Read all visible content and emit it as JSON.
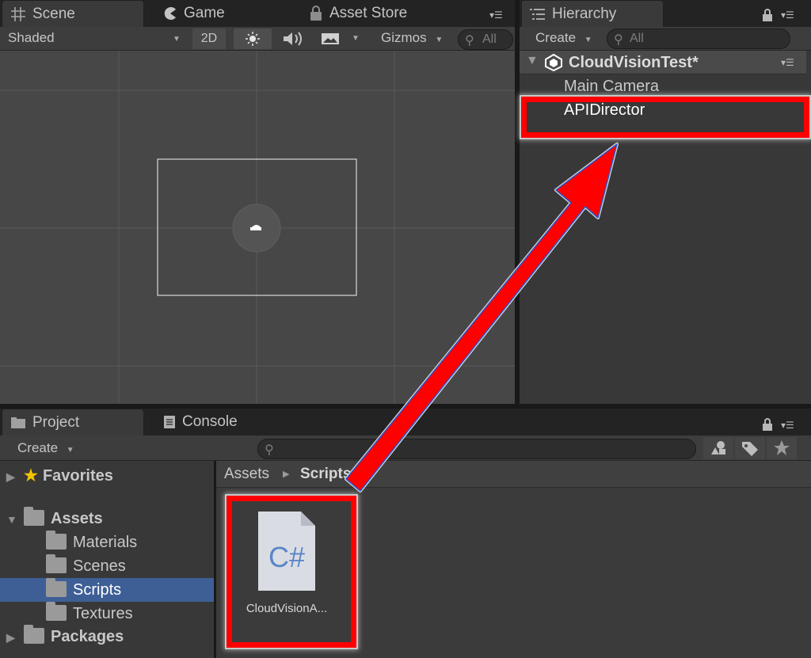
{
  "scene_panel": {
    "tabs": [
      {
        "label": "Scene",
        "icon": "grid-icon"
      },
      {
        "label": "Game",
        "icon": "pacman-icon"
      },
      {
        "label": "Asset Store",
        "icon": "lock-bag-icon"
      }
    ],
    "toolbar": {
      "shading_mode": "Shaded",
      "mode_2d": "2D",
      "gizmos": "Gizmos",
      "search_placeholder": "All"
    }
  },
  "hierarchy_panel": {
    "tab": "Hierarchy",
    "create": "Create",
    "search_placeholder": "All",
    "scene_name": "CloudVisionTest*",
    "items": [
      {
        "label": "Main Camera"
      },
      {
        "label": "APIDirector",
        "highlighted": true
      }
    ]
  },
  "project_panel": {
    "tabs": [
      {
        "label": "Project",
        "icon": "folder-icon"
      },
      {
        "label": "Console",
        "icon": "console-icon"
      }
    ],
    "create": "Create",
    "tree": {
      "favorites": "Favorites",
      "assets": "Assets",
      "children": [
        "Materials",
        "Scenes",
        "Scripts",
        "Textures"
      ],
      "selected": "Scripts",
      "packages": "Packages"
    },
    "breadcrumb": {
      "root": "Assets",
      "separator": "▶",
      "current": "Scripts"
    },
    "file": {
      "icon_text": "C#",
      "name": "CloudVisionA..."
    }
  },
  "colors": {
    "highlight": "#ff0000",
    "selection": "#3e5f96"
  }
}
